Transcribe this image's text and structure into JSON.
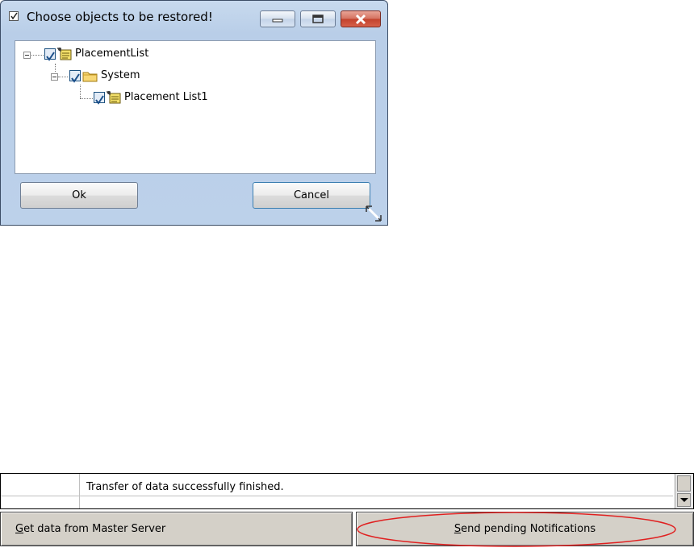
{
  "dialog": {
    "title": "Choose objects to be restored!",
    "tree": [
      {
        "label": "PlacementList",
        "checked": true,
        "icon": "placement-list-icon"
      },
      {
        "label": "System",
        "checked": true,
        "icon": "folder-icon"
      },
      {
        "label": "Placement List1",
        "checked": true,
        "icon": "placement-list-icon"
      }
    ],
    "ok_label": "Ok",
    "cancel_label": "Cancel"
  },
  "bottom": {
    "log_message": "Transfer of data successfully finished.",
    "get_data_button": {
      "mnemonic": "G",
      "rest": "et data from Master Server"
    },
    "send_button": {
      "mnemonic": "S",
      "rest": "end pending Notifications"
    },
    "highlight_color": "#e02020"
  }
}
